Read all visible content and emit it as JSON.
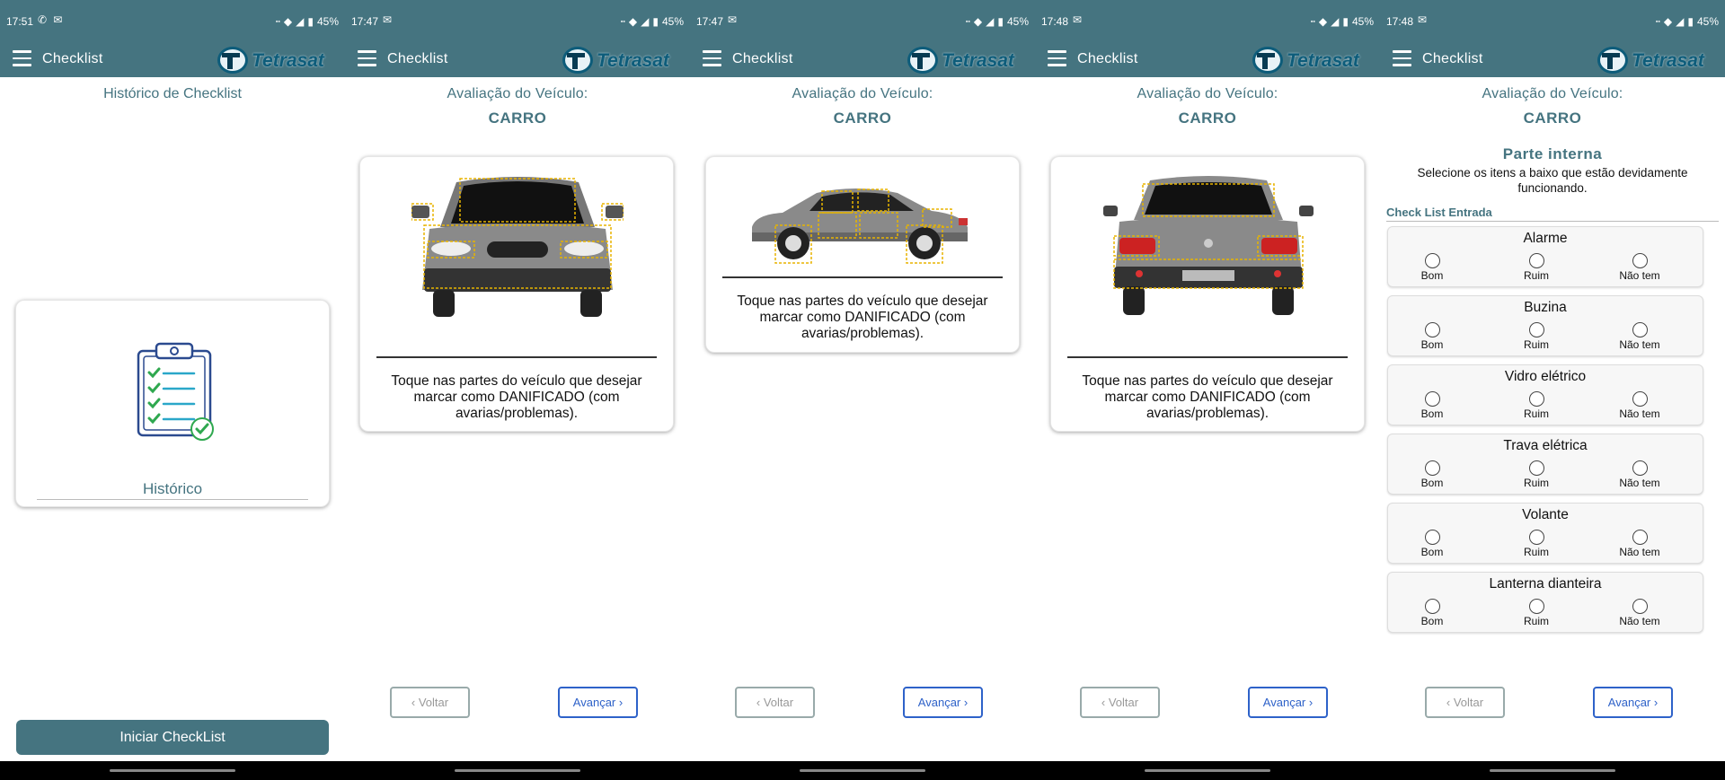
{
  "screens": [
    {
      "status": {
        "time": "17:51",
        "left_icons": "✆ ✉",
        "battery": "45%"
      },
      "appbar": {
        "title": "Checklist",
        "logo": "Tetrasat"
      },
      "title": "Histórico de Checklist",
      "history_card_label": "Histórico",
      "start_button": "Iniciar CheckList"
    },
    {
      "status": {
        "time": "17:47",
        "left_icons": "✉",
        "battery": "45%"
      },
      "appbar": {
        "title": "Checklist",
        "logo": "Tetrasat"
      },
      "heading": "Avaliação do Veículo:",
      "subheading": "CARRO",
      "view": "front",
      "instruction": "Toque nas partes do veículo que desejar marcar como DANIFICADO (com avarias/problemas).",
      "back": "‹ Voltar",
      "next": "Avançar ›"
    },
    {
      "status": {
        "time": "17:47",
        "left_icons": "✉",
        "battery": "45%"
      },
      "appbar": {
        "title": "Checklist",
        "logo": "Tetrasat"
      },
      "heading": "Avaliação do Veículo:",
      "subheading": "CARRO",
      "view": "side",
      "instruction": "Toque nas partes do veículo que desejar marcar como DANIFICADO (com avarias/problemas).",
      "back": "‹ Voltar",
      "next": "Avançar ›"
    },
    {
      "status": {
        "time": "17:48",
        "left_icons": "✉",
        "battery": "45%"
      },
      "appbar": {
        "title": "Checklist",
        "logo": "Tetrasat"
      },
      "heading": "Avaliação do Veículo:",
      "subheading": "CARRO",
      "view": "rear",
      "instruction": "Toque nas partes do veículo que desejar marcar como DANIFICADO (com avarias/problemas).",
      "back": "‹ Voltar",
      "next": "Avançar ›"
    },
    {
      "status": {
        "time": "17:48",
        "left_icons": "✉",
        "battery": "45%"
      },
      "appbar": {
        "title": "Checklist",
        "logo": "Tetrasat"
      },
      "heading": "Avaliação do Veículo:",
      "subheading": "CARRO",
      "inner_title": "Parte interna",
      "inner_desc": "Selecione os itens a baixo que estão devidamente funcionando.",
      "section_label": "Check List Entrada",
      "options": [
        "Bom",
        "Ruim",
        "Não tem"
      ],
      "items": [
        {
          "name": "Alarme"
        },
        {
          "name": "Buzina"
        },
        {
          "name": "Vidro elétrico"
        },
        {
          "name": "Trava elétrica"
        },
        {
          "name": "Volante"
        },
        {
          "name": "Lanterna dianteira"
        }
      ],
      "back": "‹ Voltar",
      "next": "Avançar ›"
    }
  ],
  "colors": {
    "teal": "#457480",
    "blue": "#2e62c9",
    "damage_box": "#e8b400"
  }
}
